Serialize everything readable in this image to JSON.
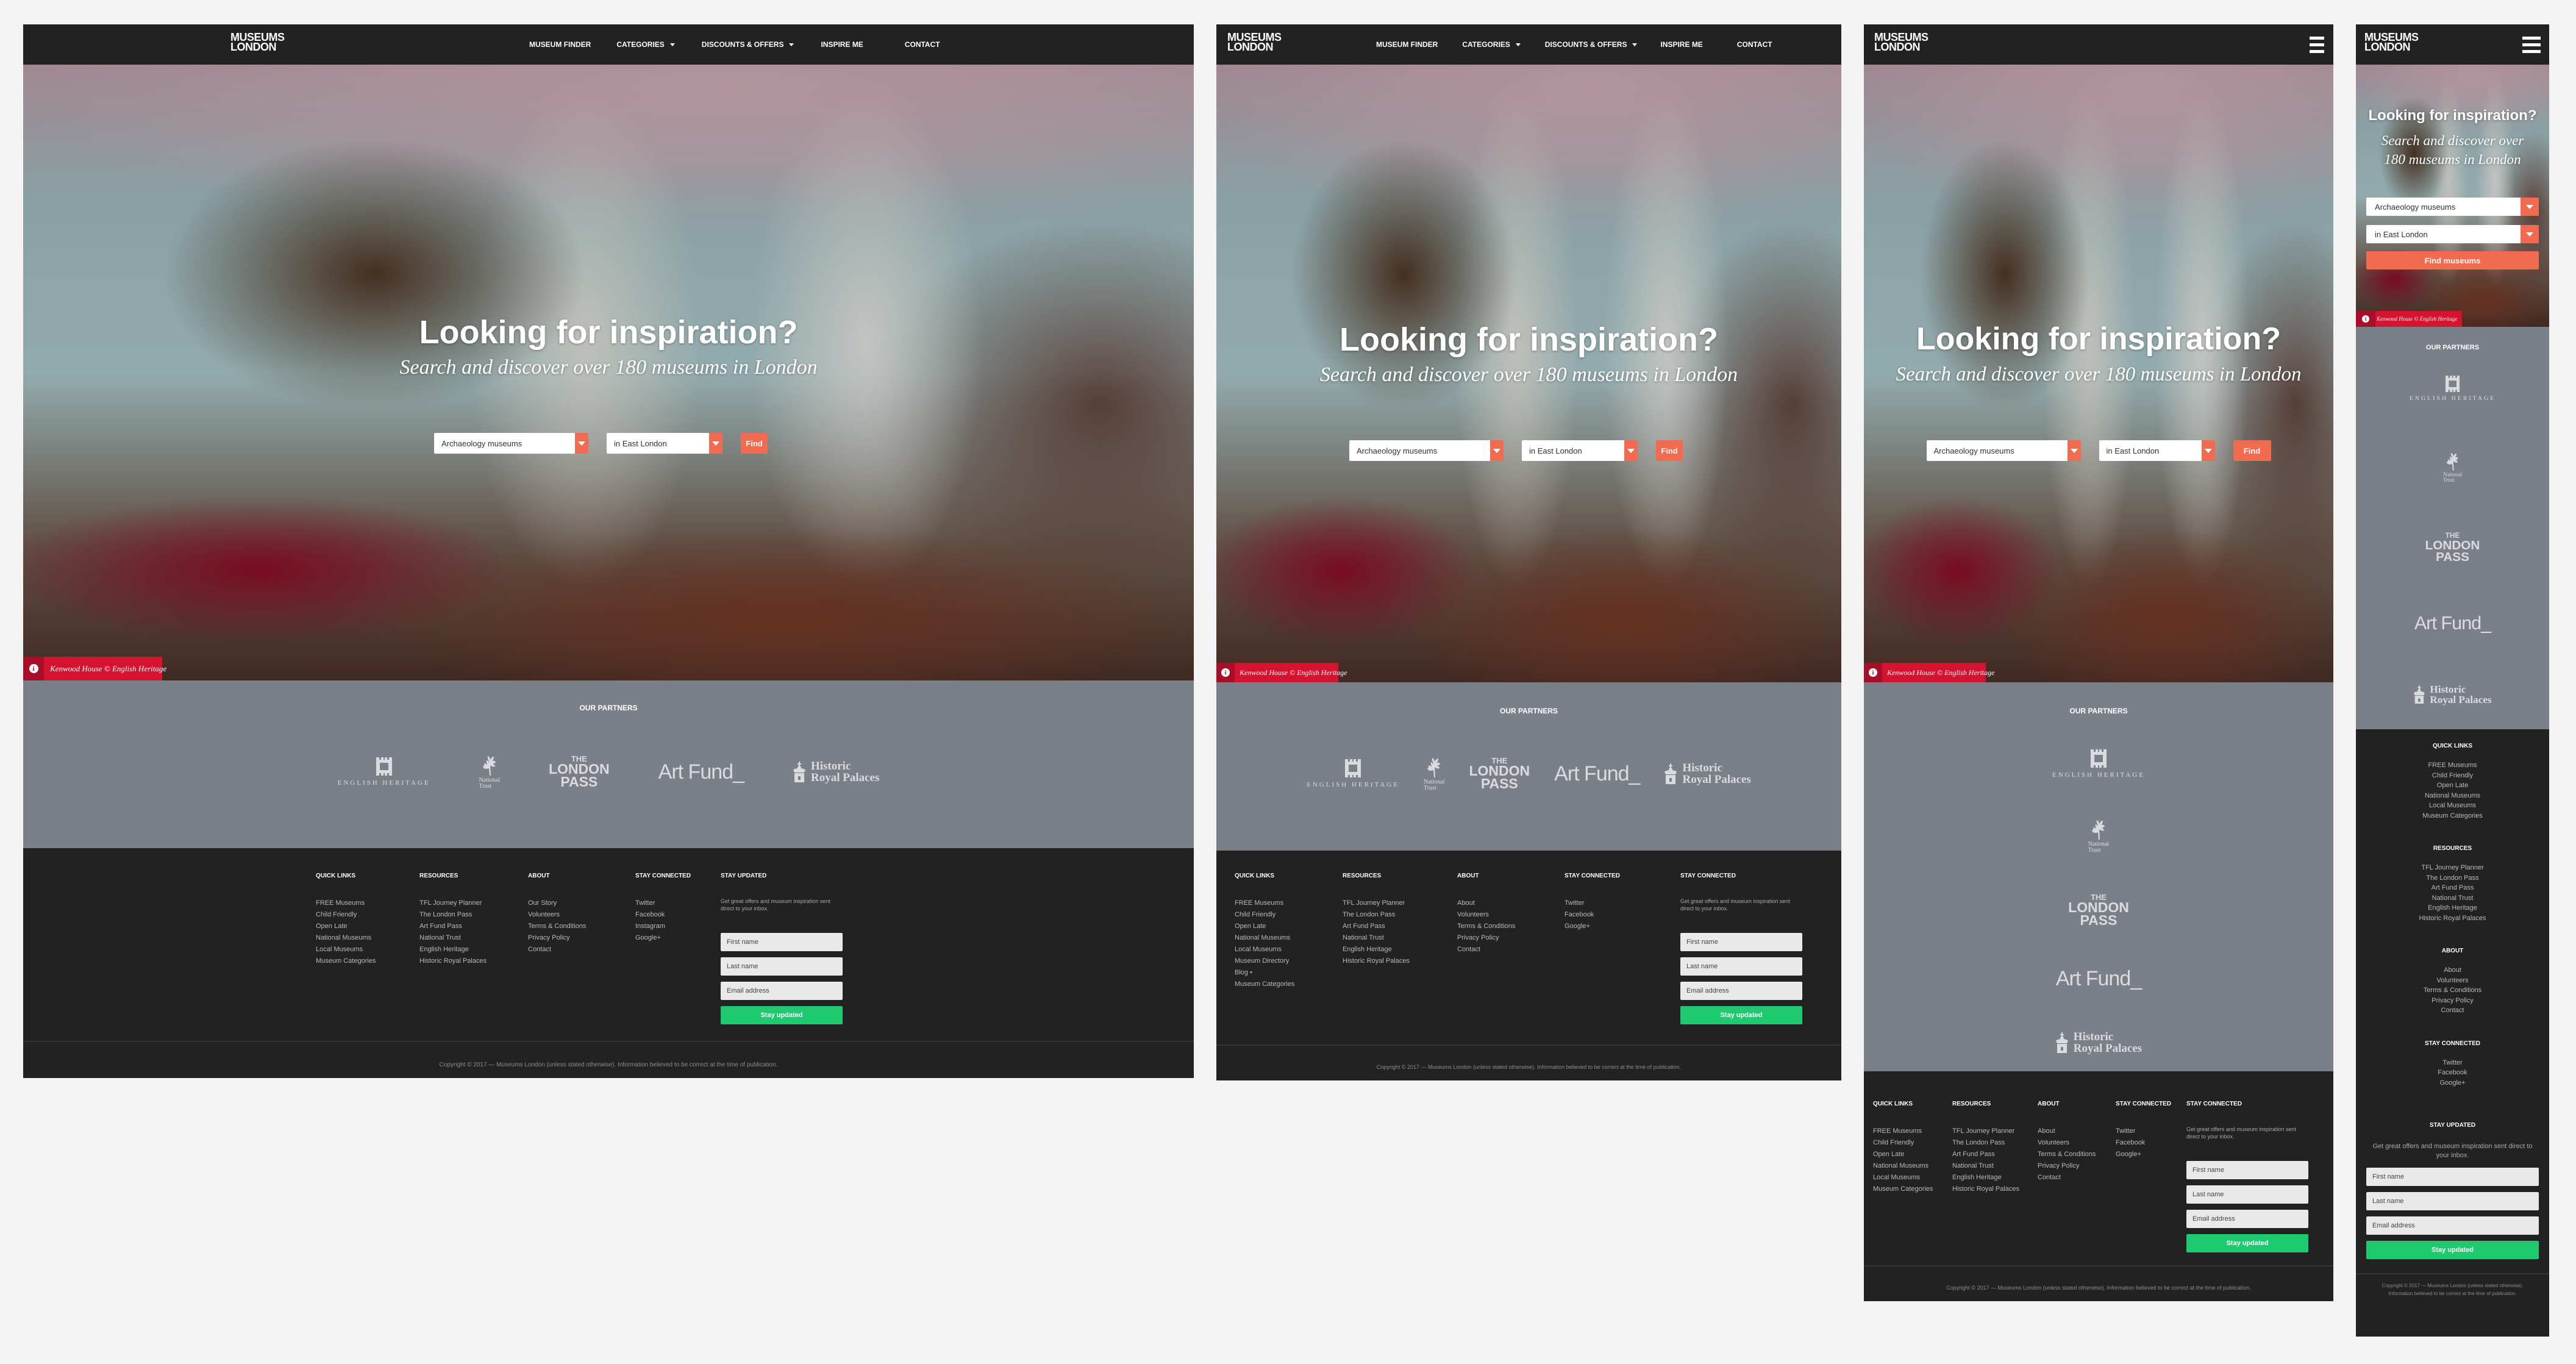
{
  "brand": {
    "logo_line1": "MUSEUMS",
    "logo_line2": "LONDON"
  },
  "nav": {
    "items": [
      {
        "label": "MUSEUM FINDER",
        "has_dropdown": false
      },
      {
        "label": "CATEGORIES",
        "has_dropdown": true
      },
      {
        "label": "DISCOUNTS & OFFERS",
        "has_dropdown": true
      },
      {
        "label": "INSPIRE ME",
        "has_dropdown": false
      },
      {
        "label": "CONTACT",
        "has_dropdown": false
      }
    ],
    "menu_icon": "hamburger-menu-icon"
  },
  "hero": {
    "title": "Looking for inspiration?",
    "subtitle": "Search and discover over 180 museums in London",
    "category_select": {
      "value": "Archaeology museums"
    },
    "area_select": {
      "value": "in East London"
    },
    "find_label": "Find",
    "find_label_mobile": "Find museums",
    "credit_icon": "info-icon",
    "credit": "Kenwood House © English Heritage"
  },
  "partners": {
    "title": "OUR PARTNERS",
    "logos": [
      {
        "name": "English Heritage",
        "text": "ENGLISH HERITAGE"
      },
      {
        "name": "National Trust",
        "line1": "National",
        "line2": "Trust"
      },
      {
        "name": "The London Pass",
        "line1": "THE",
        "line2": "LONDON",
        "line3": "PASS"
      },
      {
        "name": "Art Fund",
        "text": "Art Fund_"
      },
      {
        "name": "Historic Royal Palaces",
        "line1": "Historic",
        "line2": "Royal Palaces"
      }
    ]
  },
  "footer": {
    "quick_links": {
      "title": "QUICK LINKS",
      "items": [
        "FREE Museums",
        "Child Friendly",
        "Open Late",
        "National Museums",
        "Local Museums",
        "Museum Categories"
      ],
      "items_tablet": [
        "FREE Museums",
        "Child Friendly",
        "Open Late",
        "National Museums",
        "Local Museums",
        "Museum Directory",
        "Blog •",
        "Museum Categories"
      ]
    },
    "resources": {
      "title": "RESOURCES",
      "items": [
        "TFL Journey Planner",
        "The London Pass",
        "Art Fund Pass",
        "National Trust",
        "English Heritage",
        "Historic Royal Palaces"
      ]
    },
    "about": {
      "title": "ABOUT",
      "items": [
        "Our Story",
        "Volunteers",
        "Terms & Conditions",
        "Privacy Policy",
        "Contact"
      ],
      "items_alt": [
        "About",
        "Volunteers",
        "Terms & Conditions",
        "Privacy Policy",
        "Contact"
      ]
    },
    "stay_connected": {
      "title": "STAY CONNECTED",
      "items": [
        "Twitter",
        "Facebook",
        "Instagram",
        "Google+"
      ],
      "items_alt": [
        "Twitter",
        "Facebook",
        "Google+"
      ]
    },
    "newsletter": {
      "title": "STAY UPDATED",
      "title_alt": "STAY CONNECTED",
      "description": "Get great offers and museum inspiration sent direct to your inbox.",
      "first_name_placeholder": "First name",
      "last_name_placeholder": "Last name",
      "email_placeholder": "Email address",
      "button_label": "Stay updated"
    },
    "copyright": "Copyright © 2017 — Museums London (unless stated otherwise). Information believed to be correct at the time of publication."
  },
  "colors": {
    "header_bg": "#222222",
    "accent_orange": "#f26a4f",
    "credit_red": "#d5122f",
    "partners_bg": "#7b8088",
    "cta_green": "#1fc96f"
  }
}
